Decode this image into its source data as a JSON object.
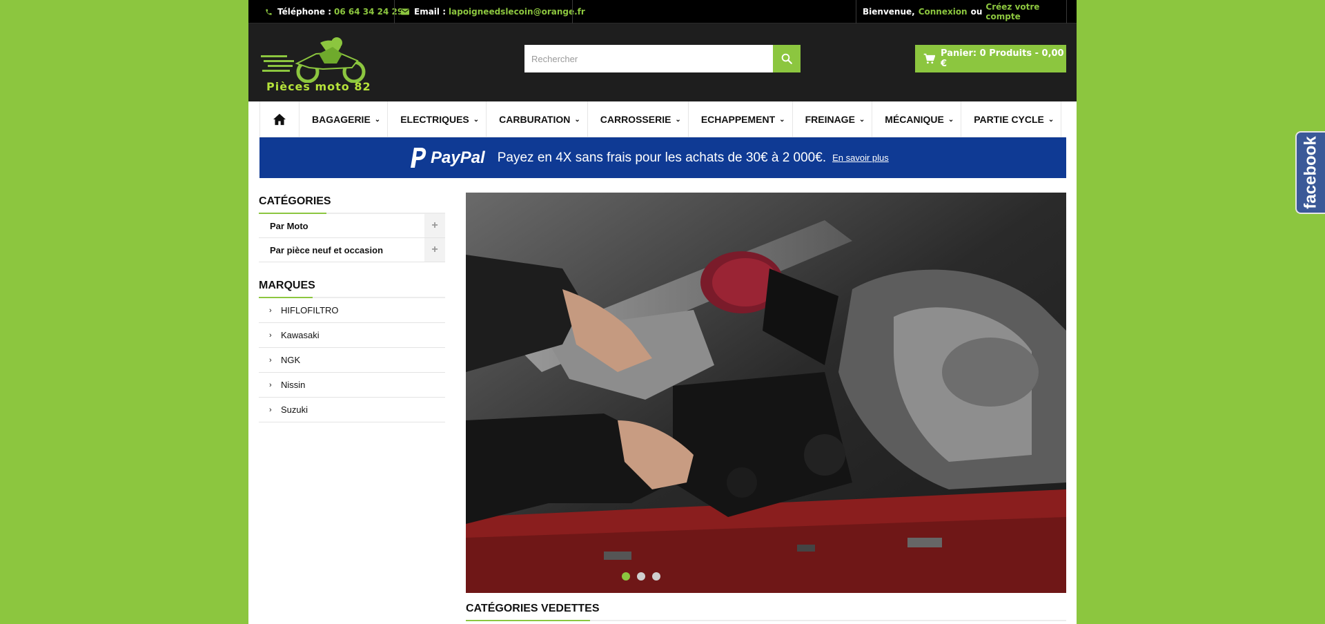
{
  "topbar": {
    "phone_label": "Téléphone :",
    "phone": "06 64 34 24 29",
    "email_label": "Email :",
    "email": "lapoigneedslecoin@orange.fr",
    "welcome": "Bienvenue,",
    "login": "Connexion",
    "or": "ou",
    "register": "Créez votre compte"
  },
  "header": {
    "logo_text": "Pièces moto 82",
    "search_placeholder": "Rechercher",
    "cart_label": "Panier: 0 Produits - 0,00 €"
  },
  "nav": {
    "items": [
      "BAGAGERIE",
      "ELECTRIQUES",
      "CARBURATION",
      "CARROSSERIE",
      "ECHAPPEMENT",
      "FREINAGE",
      "MÉCANIQUE",
      "PARTIE CYCLE"
    ]
  },
  "paypal": {
    "brand": "PayPal",
    "text": "Payez en 4X sans frais pour les achats de 30€ à 2 000€.",
    "link": "En savoir plus"
  },
  "categories": {
    "title": "CATÉGORIES",
    "items": [
      "Par Moto",
      "Par pièce neuf et occasion"
    ]
  },
  "brands": {
    "title": "MARQUES",
    "items": [
      "HIFLOFILTRO",
      "Kawasaki",
      "NGK",
      "Nissin",
      "Suzuki"
    ]
  },
  "slider": {
    "dots": 3,
    "active_index": 0
  },
  "featured": {
    "title": "CATÉGORIES VEDETTES"
  },
  "facebook": {
    "label": "facebook"
  },
  "colors": {
    "accent": "#8cc63f",
    "background": "#8cc63f",
    "header": "#1e1e1e",
    "topbar": "#000000",
    "paypal": "#0f3a94",
    "facebook": "#3b5998"
  }
}
